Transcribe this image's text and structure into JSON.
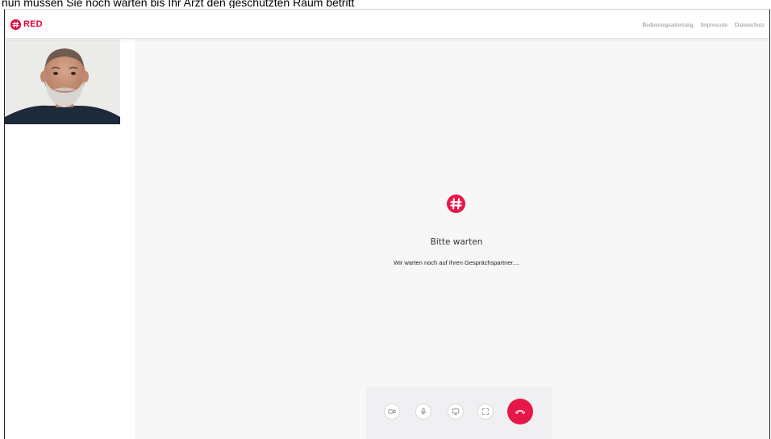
{
  "caption": "nun müssen Sie noch warten bis Ihr Arzt den geschützten Raum betritt",
  "header": {
    "brand": "RED",
    "nav": [
      {
        "label": "Bedienungsanleitung"
      },
      {
        "label": "Impressum"
      },
      {
        "label": "Datenschutz"
      }
    ]
  },
  "main": {
    "title": "Bitte warten",
    "subtitle": "Wir warten noch auf Ihren Gesprächspartner...."
  },
  "controls": {
    "camera_icon": "video-camera-icon",
    "mic_icon": "microphone-icon",
    "screen_icon": "screen-share-icon",
    "fullscreen_icon": "fullscreen-icon",
    "hangup_icon": "phone-hangup-icon"
  },
  "colors": {
    "brand": "#e4003a",
    "hangup": "#e8174a",
    "stage_background": "#f7f7f8"
  }
}
